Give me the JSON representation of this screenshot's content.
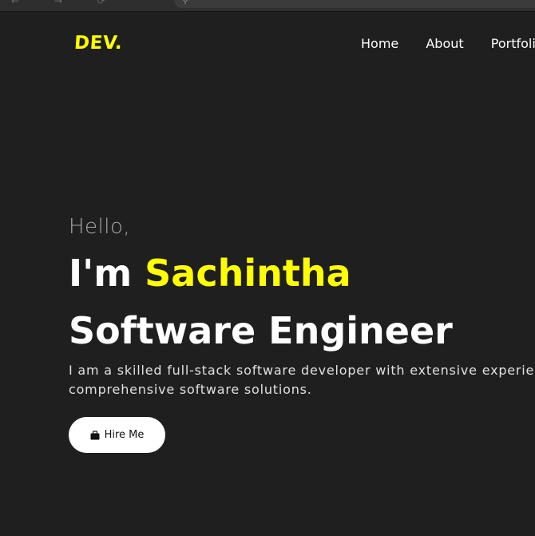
{
  "header": {
    "logo": "DEV.",
    "nav": [
      "Home",
      "About",
      "Portfolio"
    ]
  },
  "hero": {
    "greeting": "Hello,",
    "intro": "I'm ",
    "name": "Sachintha",
    "role": "Software Engineer",
    "description_line1": "I am a skilled full-stack software developer with extensive experien",
    "description_line2": "comprehensive software solutions.",
    "hire_label": "Hire Me",
    "hire_icon": "briefcase-icon"
  },
  "colors": {
    "background": "#1f1f1f",
    "accent": "#ffff00",
    "text": "#ffffff"
  }
}
